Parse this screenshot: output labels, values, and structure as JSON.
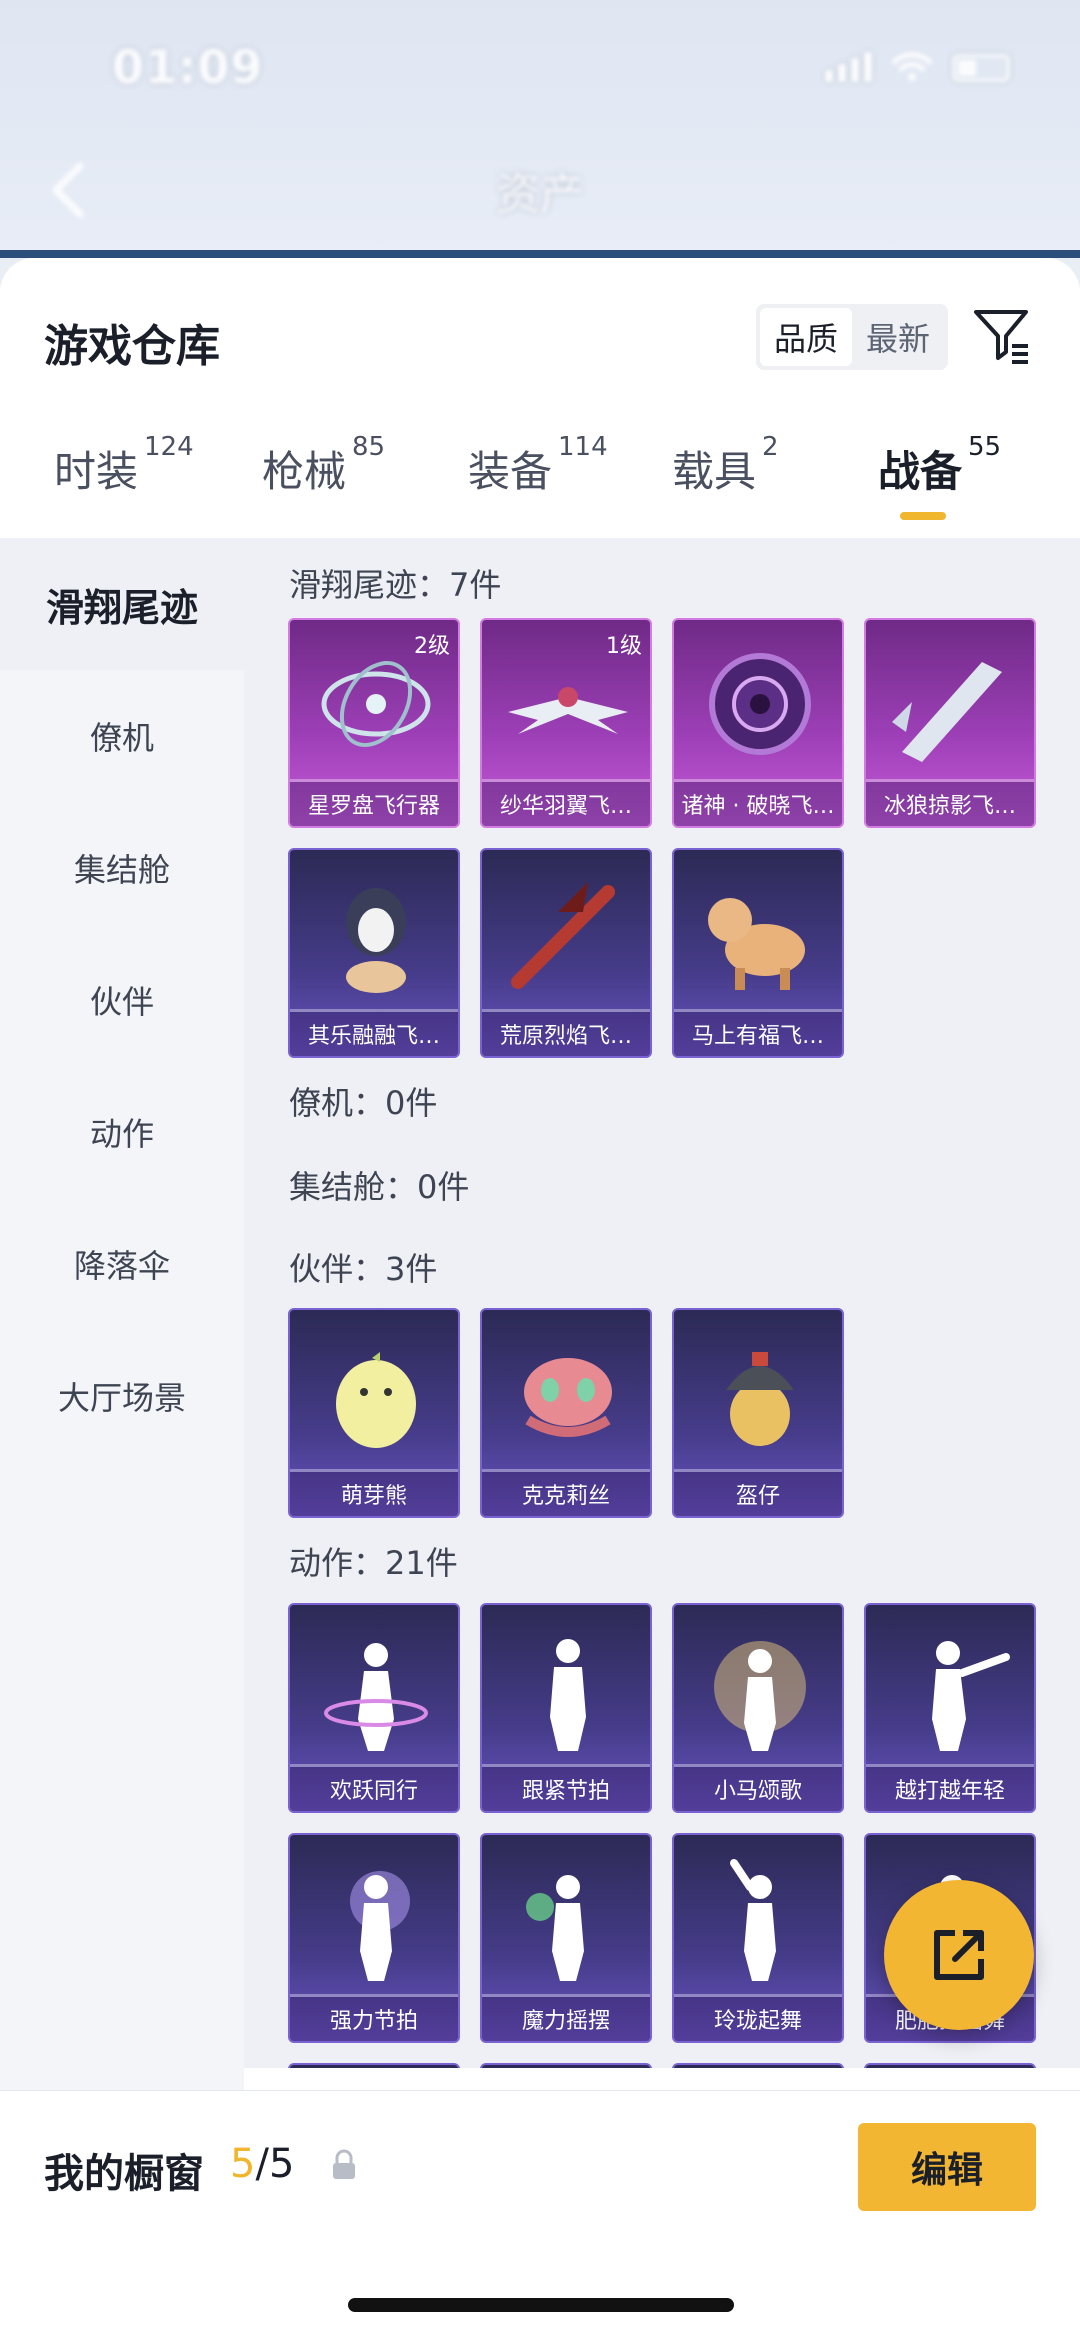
{
  "status": {
    "time": "01:09"
  },
  "nav": {
    "title": "资产"
  },
  "sheet": {
    "title": "游戏仓库",
    "sort_options": [
      "品质",
      "最新"
    ],
    "active_sort": "品质"
  },
  "tabs": [
    {
      "label": "时装",
      "count": "124"
    },
    {
      "label": "枪械",
      "count": "85"
    },
    {
      "label": "装备",
      "count": "114"
    },
    {
      "label": "载具",
      "count": "2"
    },
    {
      "label": "战备",
      "count": "55",
      "active": true
    }
  ],
  "sidebar": [
    {
      "label": "滑翔尾迹",
      "active": true
    },
    {
      "label": "僚机"
    },
    {
      "label": "集结舱"
    },
    {
      "label": "伙伴"
    },
    {
      "label": "动作"
    },
    {
      "label": "降落伞"
    },
    {
      "label": "大厅场景"
    }
  ],
  "sections": {
    "glide": {
      "label": "滑翔尾迹：7件"
    },
    "wingman": {
      "label": "僚机：0件"
    },
    "pod": {
      "label": "集结舱：0件"
    },
    "partner": {
      "label": "伙伴：3件"
    },
    "emote": {
      "label": "动作：21件"
    }
  },
  "items": {
    "glide": [
      {
        "name": "星罗盘飞行器",
        "level": "2级"
      },
      {
        "name": "纱华羽翼飞…",
        "level": "1级"
      },
      {
        "name": "诸神 · 破晓飞…"
      },
      {
        "name": "冰狼掠影飞…"
      },
      {
        "name": "其乐融融飞…"
      },
      {
        "name": "荒原烈焰飞…"
      },
      {
        "name": "马上有福飞…"
      }
    ],
    "partner": [
      {
        "name": "萌芽熊"
      },
      {
        "name": "克克莉丝"
      },
      {
        "name": "盔仔"
      }
    ],
    "emote": [
      {
        "name": "欢跃同行"
      },
      {
        "name": "跟紧节拍"
      },
      {
        "name": "小马颂歌"
      },
      {
        "name": "越打越年轻"
      },
      {
        "name": "强力节拍"
      },
      {
        "name": "魔力摇摆"
      },
      {
        "name": "玲珑起舞"
      },
      {
        "name": "肥肥摇摇舞"
      }
    ]
  },
  "window": {
    "title": "我的橱窗",
    "current": "5",
    "separator": "/",
    "total": "5"
  },
  "actions": {
    "edit": "编辑"
  },
  "colors": {
    "accent": "#f2b632",
    "rare_purple": "#9c3fb6",
    "epic_blue": "#463c8a"
  }
}
